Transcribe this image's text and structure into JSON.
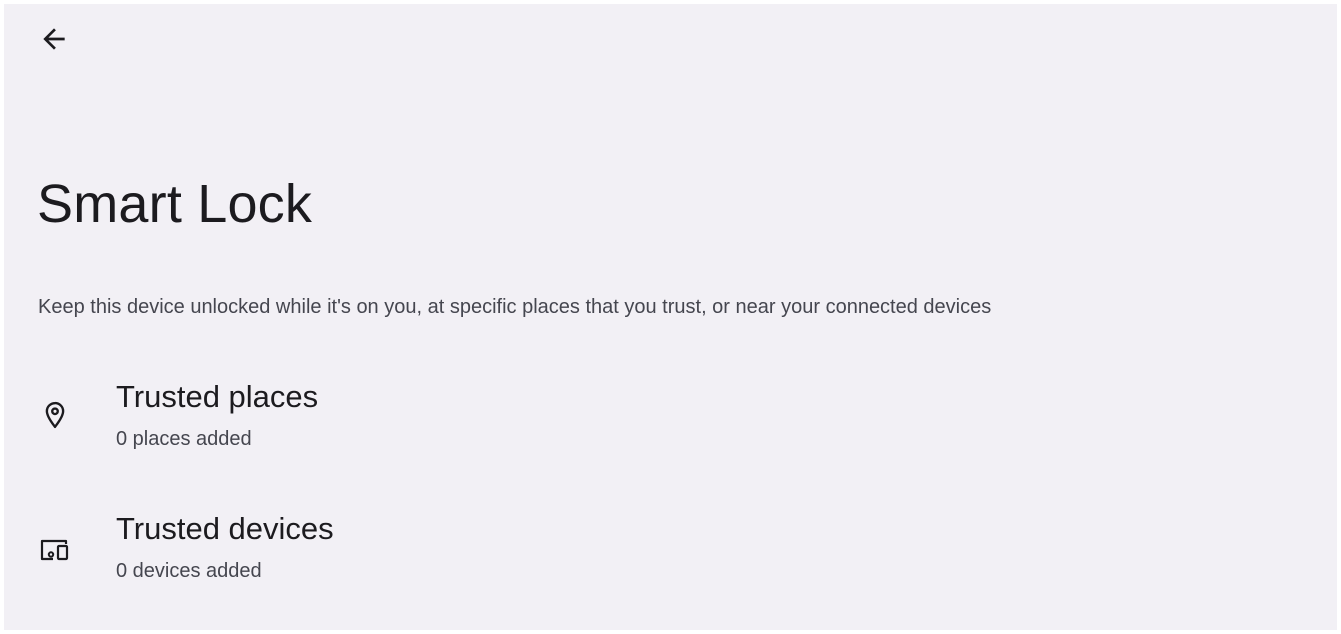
{
  "header": {
    "back_icon": "arrow-back-icon"
  },
  "page": {
    "title": "Smart Lock",
    "description": "Keep this device unlocked while it's on you, at specific places that you trust, or near your connected devices"
  },
  "options": [
    {
      "icon": "location-pin-icon",
      "title": "Trusted places",
      "subtitle": "0 places added"
    },
    {
      "icon": "devices-icon",
      "title": "Trusted devices",
      "subtitle": "0 devices added"
    }
  ],
  "colors": {
    "background": "#f2f0f5",
    "primary_text": "#1c1b1f",
    "secondary_text": "#45464f"
  }
}
